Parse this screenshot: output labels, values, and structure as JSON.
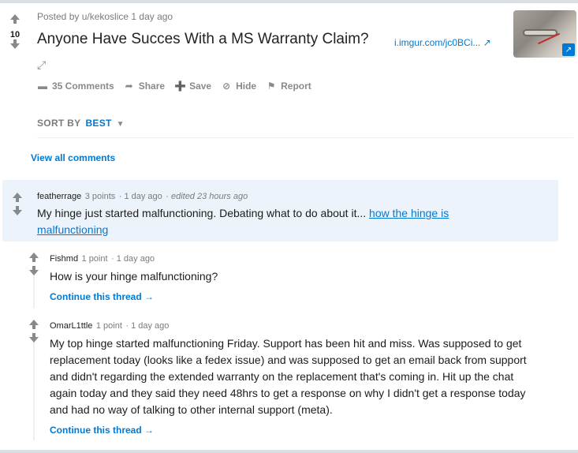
{
  "post": {
    "score": "10",
    "meta": "Posted by u/kekoslice 1 day ago",
    "title": "Anyone Have Succes With a MS Warranty Claim?",
    "domain": "i.imgur.com/jc0BCi...",
    "actions": {
      "comments": "35 Comments",
      "share": "Share",
      "save": "Save",
      "hide": "Hide",
      "report": "Report"
    }
  },
  "sort": {
    "label": "SORT BY",
    "value": "BEST"
  },
  "view_all": "View all comments",
  "comments": [
    {
      "author": "featherrage",
      "points": "3 points",
      "age": "1 day ago",
      "edited": "edited 23 hours ago",
      "text": "My hinge just started malfunctioning. Debating what to do about it...",
      "link_text": "how the hinge is malfunctioning"
    },
    {
      "author": "Fishmd",
      "points": "1 point",
      "age": "1 day ago",
      "text": "How is your hinge malfunctioning?",
      "continue": "Continue this thread"
    },
    {
      "author": "OmarL1ttle",
      "points": "1 point",
      "age": "1 day ago",
      "text": "My top hinge started malfunctioning Friday. Support has been hit and miss. Was supposed to get replacement today (looks like a fedex issue) and was supposed to get an email back from support and didn't regarding the extended warranty on the replacement that's coming in. Hit up the chat again today and they said they need 48hrs to get a response on why I didn't get a response today and had no way of talking to other internal support (meta).",
      "continue": "Continue this thread"
    }
  ],
  "colors": {
    "accent": "#0079d3",
    "muted": "#878a8c",
    "highlight": "#edf3fb"
  }
}
